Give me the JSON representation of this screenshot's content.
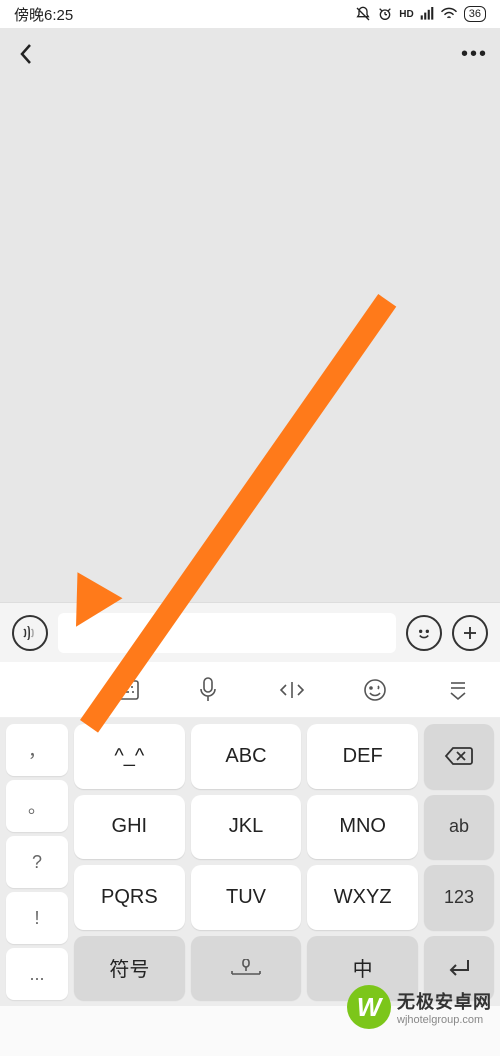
{
  "status": {
    "time": "傍晚6:25",
    "battery": "36"
  },
  "header": {
    "title_placeholder": "  "
  },
  "arrow": {
    "color": "#ff7a1a"
  },
  "input_bar": {
    "value": ""
  },
  "kb_toolbar": {
    "items": [
      "keyboard",
      "mic",
      "cursor",
      "emoji",
      "collapse"
    ]
  },
  "keyboard": {
    "left_punct": [
      "，",
      "。",
      "?",
      "!",
      "..."
    ],
    "main_rows": [
      [
        "^_^",
        "ABC",
        "DEF"
      ],
      [
        "GHI",
        "JKL",
        "MNO"
      ],
      [
        "PQRS",
        "TUV",
        "WXYZ"
      ],
      [
        "符号",
        "space",
        "中"
      ]
    ],
    "right_col": [
      "backspace",
      "ab",
      "123",
      "enter"
    ]
  },
  "watermark": {
    "logo_letter": "W",
    "line1": "无极安卓网",
    "line2": "wjhotelgroup.com"
  }
}
